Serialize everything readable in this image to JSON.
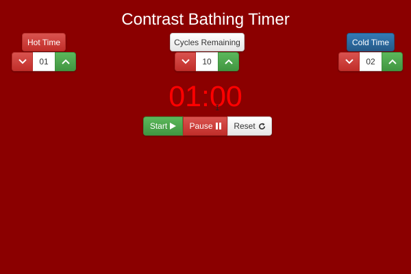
{
  "title": "Contrast Bathing Timer",
  "hot": {
    "label": "Hot Time",
    "value": "01"
  },
  "cycles": {
    "label": "Cycles Remaining",
    "value": "10"
  },
  "cold": {
    "label": "Cold Time",
    "value": "02"
  },
  "timer": {
    "display": "01:00"
  },
  "controls": {
    "start": "Start",
    "pause": "Pause",
    "reset": "Reset"
  },
  "icons": {
    "decrement": "chevron-down-icon",
    "increment": "chevron-up-icon",
    "start": "play-icon",
    "pause": "pause-icon",
    "reset": "refresh-icon",
    "cursor": "text-cursor-icon"
  },
  "colors": {
    "background": "#8b0000",
    "timer": "#ff0000",
    "green": "#5cb85c",
    "red": "#d9534f",
    "blue": "#337ab7"
  }
}
